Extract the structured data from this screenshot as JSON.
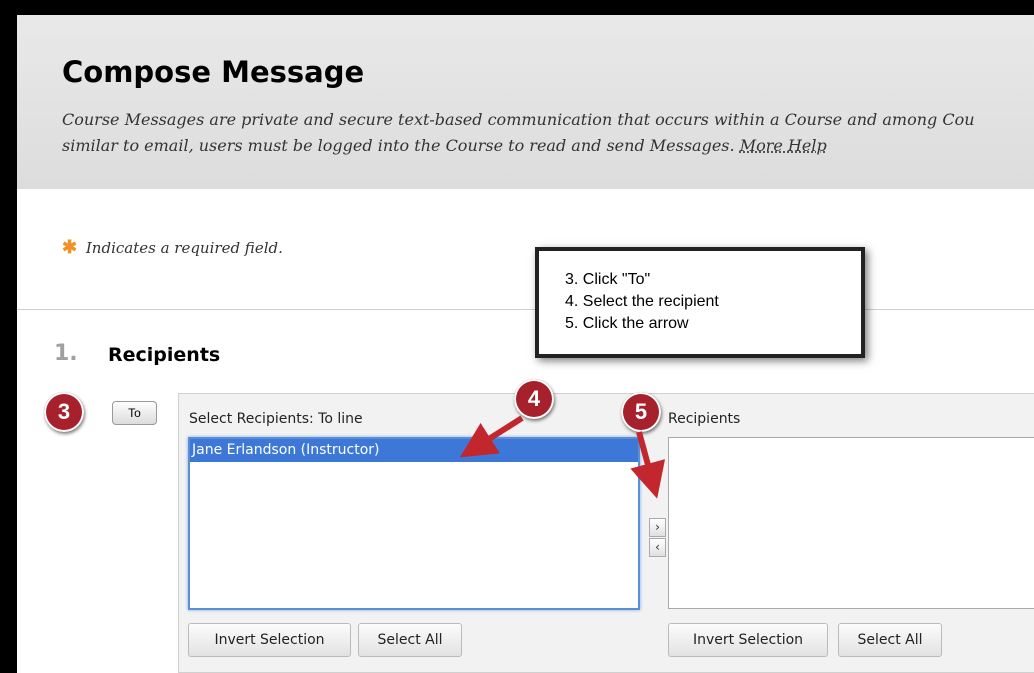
{
  "header": {
    "title": "Compose Message",
    "description_line1": "Course Messages are private and secure text-based communication that occurs within a Course and among Cou",
    "description_line2": "similar to email, users must be logged into the Course to read and send Messages. ",
    "more_help": "More Help"
  },
  "required_note": {
    "star": "✱",
    "text": "Indicates a required field."
  },
  "section": {
    "number": "1.",
    "title": "Recipients"
  },
  "to_button": "To",
  "select_panel": {
    "label": "Select Recipients: To line",
    "options": [
      "Jane Erlandson (Instructor)"
    ],
    "invert_label": "Invert Selection",
    "select_all_label": "Select All"
  },
  "move_buttons": {
    "right": "›",
    "left": "‹"
  },
  "recipients_panel": {
    "label": "Recipients",
    "invert_label": "Invert Selection",
    "select_all_label": "Select All"
  },
  "callout": {
    "line1": "3. Click \"To\"",
    "line2": "4. Select the recipient",
    "line3": "5. Click the arrow"
  },
  "badges": {
    "three": "3",
    "four": "4",
    "five": "5"
  },
  "colors": {
    "badge": "#a6212b",
    "selection": "#3d78d8",
    "required_star": "#f29226",
    "arrow": "#c1272d"
  }
}
